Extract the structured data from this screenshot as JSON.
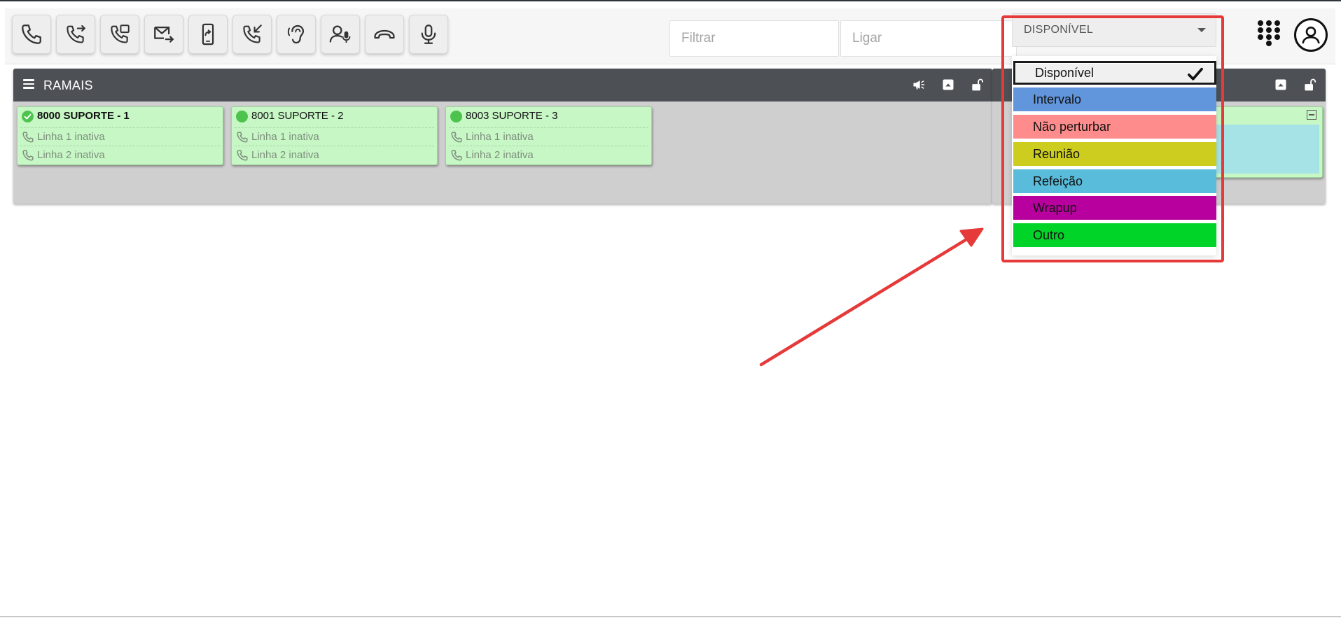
{
  "toolbar": {
    "buttons": [
      {
        "name": "call-button",
        "icon": "phone-icon"
      },
      {
        "name": "transfer-button",
        "icon": "phone-forward-icon"
      },
      {
        "name": "attended-transfer-button",
        "icon": "phone-transfer-icon"
      },
      {
        "name": "forward-mail-button",
        "icon": "mail-forward-icon"
      },
      {
        "name": "mobile-forward-button",
        "icon": "mobile-forward-icon"
      },
      {
        "name": "pickup-button",
        "icon": "phone-incoming-icon"
      },
      {
        "name": "listen-button",
        "icon": "ear-icon"
      },
      {
        "name": "whisper-button",
        "icon": "user-mic-icon"
      },
      {
        "name": "hangup-button",
        "icon": "phone-hangup-icon"
      },
      {
        "name": "mute-button",
        "icon": "microphone-icon"
      }
    ],
    "filter_placeholder": "Filtrar",
    "dial_placeholder": "Ligar",
    "status_value": "DISPONÍVEL"
  },
  "status_menu": {
    "items": [
      {
        "label": "Disponível",
        "color": "#f0f0f0",
        "selected": true
      },
      {
        "label": "Intervalo",
        "color": "#6195dc"
      },
      {
        "label": "Não perturbar",
        "color": "#ff8c8c"
      },
      {
        "label": "Reunião",
        "color": "#cdcd1f"
      },
      {
        "label": "Refeição",
        "color": "#59bcdb"
      },
      {
        "label": "Wrapup",
        "color": "#b8009e"
      },
      {
        "label": "Outro",
        "color": "#00d428"
      }
    ]
  },
  "panel": {
    "title": "RAMAIS",
    "extensions": [
      {
        "title": "8000 SUPORTE - 1",
        "line1": "Linha 1 inativa",
        "line2": "Linha 2 inativa",
        "current_user": true
      },
      {
        "title": "8001 SUPORTE - 2",
        "line1": "Linha 1 inativa",
        "line2": "Linha 2 inativa"
      },
      {
        "title": "8003 SUPORTE - 3",
        "line1": "Linha 1 inativa",
        "line2": "Linha 2 inativa"
      }
    ]
  },
  "colors": {
    "accent_red": "#e63a3a",
    "header_dark": "#4d5055",
    "card_green": "#c7f7c5",
    "status_green": "#4cc34c"
  }
}
